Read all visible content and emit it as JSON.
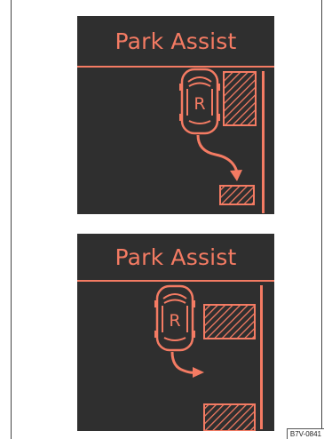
{
  "panels": [
    {
      "title": "Park Assist",
      "gear_indicator": "R"
    },
    {
      "title": "Park Assist",
      "gear_indicator": "R"
    }
  ],
  "figure_code": "B7V-0841",
  "colors": {
    "display_background": "#2f2f2f",
    "accent": "#f47b63",
    "page_background": "#ffffff"
  },
  "icons": {
    "vehicle": "car-top-view-icon",
    "parking_space": "hatched-parking-space-icon",
    "curb": "curb-line-icon",
    "path": "curved-arrow-icon"
  }
}
